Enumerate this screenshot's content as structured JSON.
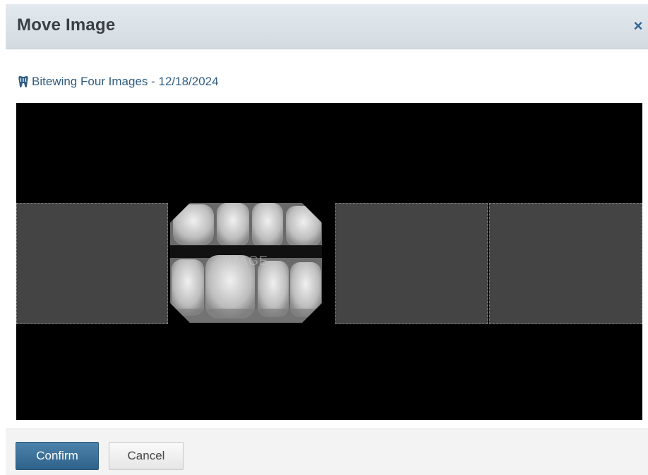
{
  "dialog": {
    "title": "Move Image",
    "close_glyph": "×"
  },
  "series": {
    "icon": "tooth-icon",
    "label": "Bitewing Four Images - 12/18/2024"
  },
  "viewer": {
    "slots": [
      {
        "state": "empty"
      },
      {
        "state": "image",
        "watermark": "IMAGE"
      },
      {
        "state": "empty"
      },
      {
        "state": "empty"
      }
    ]
  },
  "footer": {
    "confirm_label": "Confirm",
    "cancel_label": "Cancel"
  },
  "colors": {
    "accent": "#2f628a",
    "link": "#2f5c82",
    "viewer_bg": "#000000",
    "empty_slot": "#444444"
  }
}
